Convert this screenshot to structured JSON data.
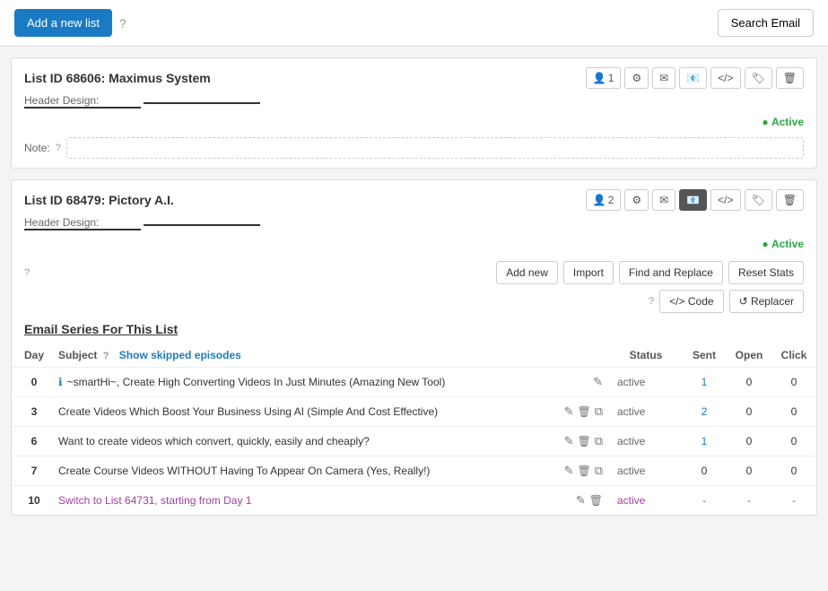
{
  "topbar": {
    "add_list_label": "Add a new list",
    "search_email_label": "Search Email"
  },
  "list1": {
    "title": "List ID 68606: Maximus System",
    "header_design_label": "Header Design:",
    "note_label": "Note:",
    "note_placeholder": "",
    "status": "Active",
    "actions": {
      "people": "1",
      "gear": "⚙",
      "envelope": "✉",
      "subscribe": "✉",
      "code": "</>",
      "tag": "🏷",
      "trash": "🗑"
    }
  },
  "list2": {
    "title": "List ID 68479: Pictory A.I.",
    "header_design_label": "Header Design:",
    "status": "Active",
    "actions": {
      "people": "2",
      "gear": "⚙",
      "envelope": "✉",
      "subscribe": "✉",
      "code": "</>",
      "tag": "🏷",
      "trash": "🗑"
    },
    "toolbar": {
      "add_new": "Add new",
      "import": "Import",
      "find_replace": "Find and Replace",
      "reset_stats": "Reset Stats",
      "code_btn": "Code",
      "replacer_btn": "Replacer"
    },
    "series_title": "Email Series For This List",
    "table": {
      "headers": {
        "day": "Day",
        "subject": "Subject",
        "show_skipped": "Show skipped episodes",
        "status": "Status",
        "sent": "Sent",
        "open": "Open",
        "click": "Click"
      },
      "rows": [
        {
          "day": "0",
          "info": true,
          "subject": "~smartHi~, Create High Converting Videos In Just Minutes (Amazing New Tool)",
          "is_link": false,
          "actions": [
            "edit"
          ],
          "status": "active",
          "sent": "1",
          "sent_link": true,
          "open": "0",
          "click": "0"
        },
        {
          "day": "3",
          "info": false,
          "subject": "Create Videos Which Boost Your Business Using AI (Simple And Cost Effective)",
          "is_link": false,
          "actions": [
            "edit",
            "delete",
            "copy"
          ],
          "status": "active",
          "sent": "2",
          "sent_link": true,
          "open": "0",
          "click": "0"
        },
        {
          "day": "6",
          "info": false,
          "subject": "Want to create videos which convert, quickly, easily and cheaply?",
          "is_link": false,
          "actions": [
            "edit",
            "delete",
            "copy"
          ],
          "status": "active",
          "sent": "1",
          "sent_link": true,
          "open": "0",
          "click": "0"
        },
        {
          "day": "7",
          "info": false,
          "subject": "Create Course Videos WITHOUT Having To Appear On Camera (Yes, Really!)",
          "is_link": false,
          "actions": [
            "edit",
            "delete",
            "copy"
          ],
          "status": "active",
          "sent": "0",
          "sent_link": false,
          "open": "0",
          "click": "0"
        },
        {
          "day": "10",
          "info": false,
          "subject": "Switch to List 64731, starting from Day 1",
          "is_link": true,
          "actions": [
            "edit",
            "delete"
          ],
          "status": "active",
          "sent": "-",
          "sent_link": false,
          "open": "-",
          "click": "-"
        }
      ]
    }
  }
}
